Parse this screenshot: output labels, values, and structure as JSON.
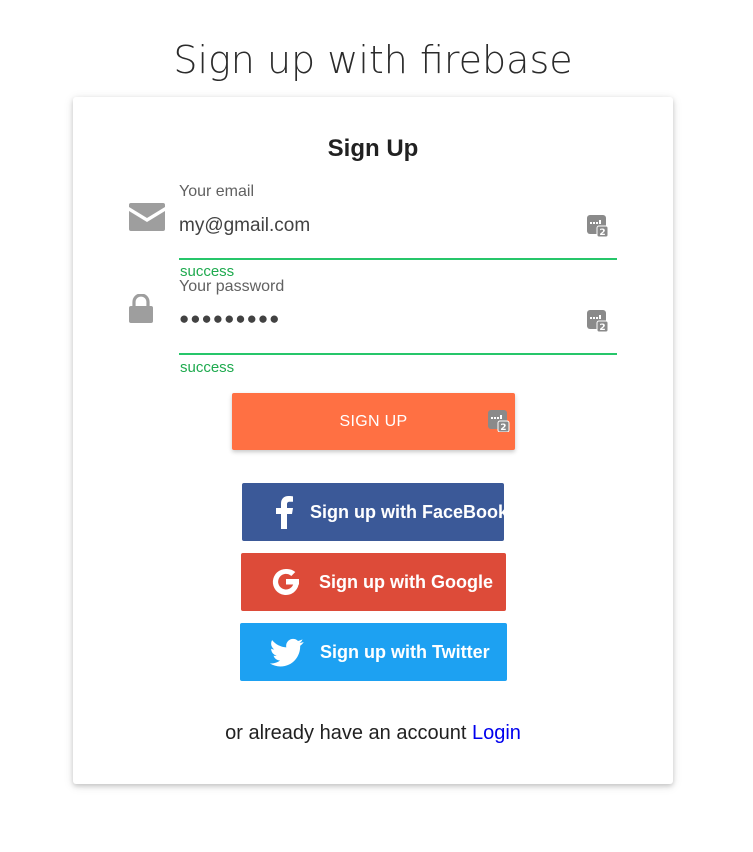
{
  "page": {
    "title": "Sign up with firebase"
  },
  "card": {
    "title": "Sign Up",
    "email": {
      "icon": "envelope-icon",
      "label": "Your email",
      "value": "my@gmail.com",
      "helper": "success"
    },
    "password": {
      "icon": "lock-icon",
      "label": "Your password",
      "value": "●●●●●●●●●",
      "helper": "success"
    },
    "signup_button": "Sign up",
    "social": {
      "facebook": {
        "label": "Sign up with FaceBook",
        "icon": "facebook-icon",
        "color": "#3b5998"
      },
      "google": {
        "label": "Sign up with Google",
        "icon": "google-icon",
        "color": "#dd4b39"
      },
      "twitter": {
        "label": "Sign up with Twitter",
        "icon": "twitter-icon",
        "color": "#1da1f2"
      }
    },
    "footer": {
      "text": "or already have an account",
      "link": "Login"
    }
  },
  "colors": {
    "accent": "#ff7043",
    "success": "#26c66a",
    "link": "#0000ee"
  }
}
